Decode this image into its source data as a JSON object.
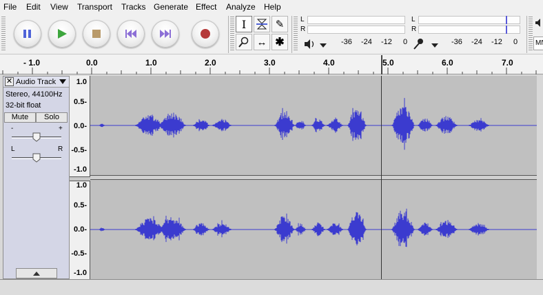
{
  "menu": [
    "File",
    "Edit",
    "View",
    "Transport",
    "Tracks",
    "Generate",
    "Effect",
    "Analyze",
    "Help"
  ],
  "transport": {
    "pause": "pause-icon",
    "play": "play-icon",
    "stop": "stop-icon",
    "skip_start": "skip-to-start-icon",
    "skip_end": "skip-to-end-icon",
    "record": "record-icon"
  },
  "tools": {
    "selection": "I",
    "envelope": "envelope-icon",
    "draw": "✎",
    "zoom": "🔍",
    "timeshift": "↔",
    "multi": "✱"
  },
  "meters": {
    "playback_channels": [
      "L",
      "R"
    ],
    "record_channels": [
      "L",
      "R"
    ],
    "playback_scale": [
      "-36",
      "-24",
      "-12",
      "0"
    ],
    "record_scale": [
      "-36",
      "-24",
      "-12",
      "0"
    ],
    "right_edge_label": "MN"
  },
  "ruler": {
    "labels": [
      "- 1.0",
      "0.0",
      "1.0",
      "2.0",
      "3.0",
      "4.0",
      "5.0",
      "6.0",
      "7.0"
    ]
  },
  "track": {
    "name": "Audio Track",
    "info_line1": "Stereo, 44100Hz",
    "info_line2": "32-bit float",
    "mute": "Mute",
    "solo": "Solo",
    "gain_minus": "-",
    "gain_plus": "+",
    "pan_left": "L",
    "pan_right": "R",
    "scale": [
      "1.0",
      "0.5-",
      "0.0-",
      "-0.5-",
      "-1.0"
    ]
  },
  "colors": {
    "waveform": "#3b3bcf",
    "track_bg": "#c0c0c0",
    "panel_bg": "#d4d6e6",
    "record_red": "#b53a3a",
    "play_green": "#3da63d",
    "transport_blue": "#4f63d8"
  }
}
